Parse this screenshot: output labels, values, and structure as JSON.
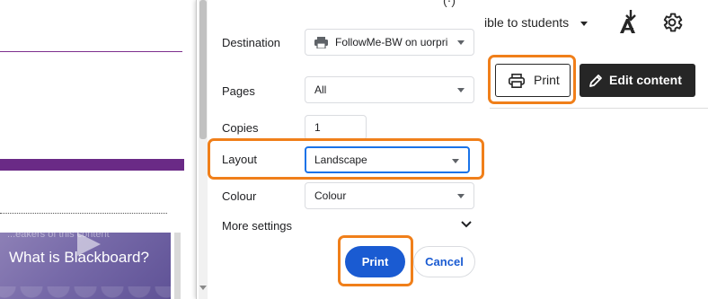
{
  "left": {
    "faded_text": "...eakers of this content",
    "video_title": "What is Blackboard?"
  },
  "dialog": {
    "top_hint": "(·)",
    "destination": {
      "label": "Destination",
      "value": "FollowMe-BW on uorpri"
    },
    "pages": {
      "label": "Pages",
      "value": "All"
    },
    "copies": {
      "label": "Copies",
      "value": "1"
    },
    "layout": {
      "label": "Layout",
      "value": "Landscape"
    },
    "colour": {
      "label": "Colour",
      "value": "Colour"
    },
    "more_settings": "More settings",
    "print_button": "Print",
    "cancel_button": "Cancel"
  },
  "toolbar": {
    "visibility": "ible to students",
    "print_button": "Print",
    "edit_button": "Edit content"
  },
  "colors": {
    "highlight": "#f07f1a",
    "primary_blue": "#1a5bd2",
    "purple": "#6a2a86",
    "dark": "#262626"
  },
  "icons": [
    "printer-icon",
    "caret-down-icon",
    "chevron-down-icon",
    "accessibility-download-icon",
    "gear-icon",
    "pencil-icon",
    "play-icon"
  ]
}
